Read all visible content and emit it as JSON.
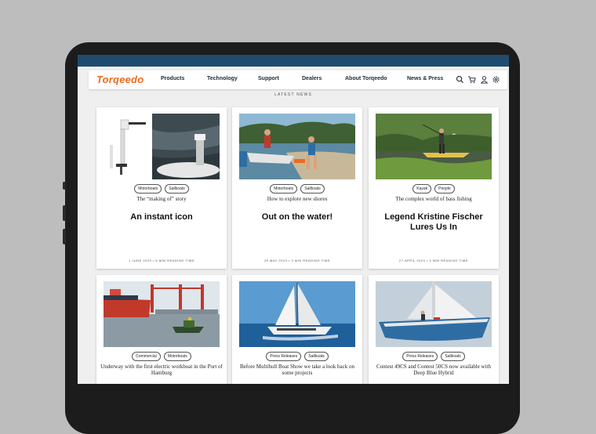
{
  "nav": {
    "logo": "Torqeedo",
    "items": [
      "Products",
      "Technology",
      "Support",
      "Dealers",
      "About Torqeedo",
      "News & Press"
    ],
    "icons": [
      "search-icon",
      "cart-icon",
      "user-icon",
      "gear-icon"
    ]
  },
  "section_title": "LATEST NEWS",
  "cards": [
    {
      "tags": [
        "Motorboats",
        "Sailboats"
      ],
      "subtitle": "The “making of” story",
      "title": "An instant icon",
      "meta": "1 JUNE 2023 • 6 MIN READING TIME"
    },
    {
      "tags": [
        "Motorboats",
        "Sailboats"
      ],
      "subtitle": "How to explore new shores",
      "title": "Out on the water!",
      "meta": "25 MAY 2023 • 3 MIN READING TIME"
    },
    {
      "tags": [
        "Kayak",
        "People"
      ],
      "subtitle": "The complex world of bass fishing",
      "title": "Legend Kristine Fischer Lures Us In",
      "meta": "27 APRIL 2023 • 3 MIN READING TIME"
    },
    {
      "tags": [
        "Commercial",
        "Motorboats"
      ],
      "subtitle": "Underway with the first electric workboat in the Port of Hamburg",
      "title": "",
      "meta": ""
    },
    {
      "tags": [
        "Press Releases",
        "Sailboats"
      ],
      "subtitle": "Before Multihull Boat Show we take a look back on some projects",
      "title": "",
      "meta": ""
    },
    {
      "tags": [
        "Press Releases",
        "Sailboats"
      ],
      "subtitle": "Contest 49CS and Contest 50CS now available with Deep Blue Hybrid",
      "title": "",
      "meta": ""
    }
  ],
  "colors": {
    "brand_orange": "#ee6a1e",
    "topbar": "#1f4c6e",
    "text_dark": "#111111"
  }
}
